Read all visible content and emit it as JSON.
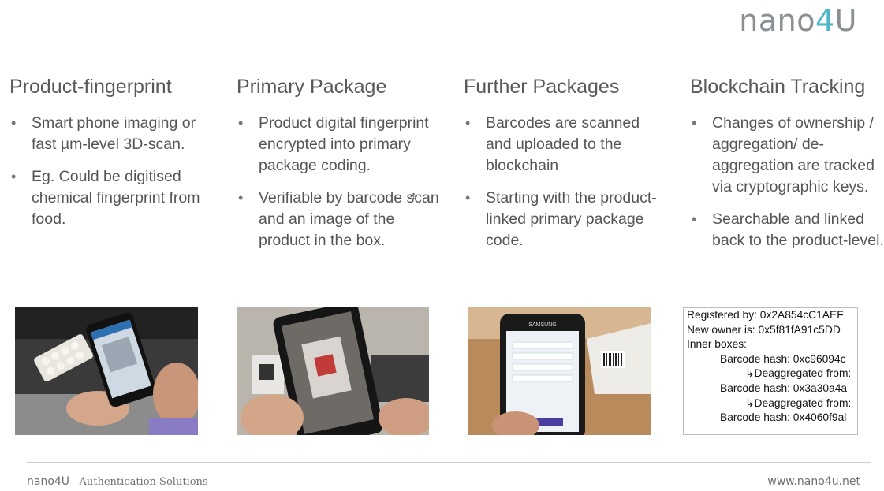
{
  "logo": {
    "prefix": "nano",
    "digit": "4",
    "suffix": "U"
  },
  "columns": [
    {
      "title": "Product-fingerprint",
      "bullets": [
        "Smart phone imaging or fast µm-level 3D-scan.",
        "Eg. Could be  digitised chemical fingerprint from food."
      ]
    },
    {
      "title": "Primary Package",
      "bullets": [
        "Product digital fingerprint encrypted into primary package coding.",
        "Verifiable by barcode scan and an image of the product in the box."
      ]
    },
    {
      "title": "Further Packages",
      "bullets": [
        "Barcodes are scanned and uploaded to the blockchain",
        "Starting with the product-linked primary package code."
      ]
    },
    {
      "title": "Blockchain Tracking",
      "bullets": [
        "Changes of ownership / aggregation/ de-aggregation are tracked via cryptographic keys.",
        "Searchable and linked back to the product-level."
      ]
    }
  ],
  "photos": {
    "phone_brand": "SAMSUNG"
  },
  "hash_box": {
    "lines": [
      "Registered by: 0x2A854cC1AEF",
      "New owner is: 0x5f81fA91c5DD",
      "Inner boxes:",
      "Barcode hash: 0xc96094c",
      "↳Deaggregated from:",
      "Barcode hash: 0x3a30a4a",
      "↳Deaggregated from:",
      "Barcode hash: 0x4060f9al"
    ]
  },
  "footer": {
    "brand": "nano4U",
    "tagline": "Authentication Solutions",
    "url": "www.nano4u.net"
  }
}
